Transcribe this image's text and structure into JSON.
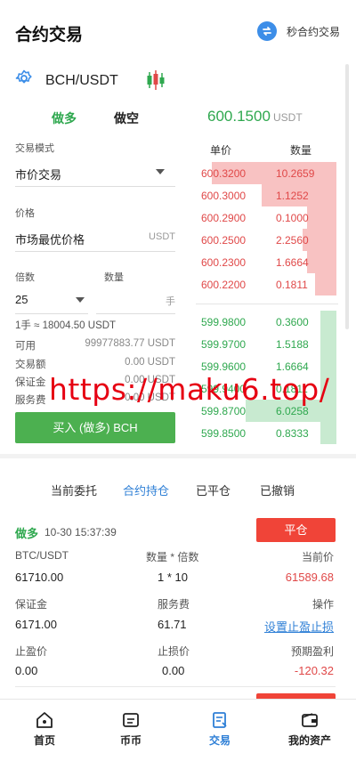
{
  "header": {
    "title": "合约交易",
    "switch_label": "秒合约交易"
  },
  "pair": {
    "name": "BCH/USDT"
  },
  "side_tabs": {
    "long": "做多",
    "short": "做空"
  },
  "ticker": {
    "price": "600.1500",
    "unit": "USDT"
  },
  "form": {
    "mode_label": "交易模式",
    "mode_value": "市价交易",
    "price_label": "价格",
    "price_value": "市场最优价格",
    "price_unit": "USDT",
    "leverage_label": "倍数",
    "qty_label": "数量",
    "leverage_value": "25",
    "qty_unit": "手",
    "lot_hint": "1手 ≈ 18004.50 USDT",
    "available_label": "可用",
    "available_value": "99977883.77 USDT",
    "amount_label": "交易额",
    "amount_value": "0.00 USDT",
    "margin_label": "保证金",
    "margin_value": "0.00 USDT",
    "fee_label": "服务费",
    "fee_value": "0.00 USDT",
    "buy_button": "买入 (做多) BCH"
  },
  "orderbook": {
    "price_header": "单价",
    "qty_header": "数量",
    "asks": [
      {
        "price": "600.3200",
        "qty": "10.2659",
        "depth": 0.92
      },
      {
        "price": "600.3000",
        "qty": "1.1252",
        "depth": 0.55
      },
      {
        "price": "600.2900",
        "qty": "0.1000",
        "depth": 0.22
      },
      {
        "price": "600.2500",
        "qty": "2.2560",
        "depth": 0.25
      },
      {
        "price": "600.2300",
        "qty": "1.6664",
        "depth": 0.22
      },
      {
        "price": "600.2200",
        "qty": "0.1811",
        "depth": 0.16
      }
    ],
    "bids": [
      {
        "price": "599.9800",
        "qty": "0.3600",
        "depth": 0.12
      },
      {
        "price": "599.9700",
        "qty": "1.5188",
        "depth": 0.12
      },
      {
        "price": "599.9600",
        "qty": "1.6664",
        "depth": 0.12
      },
      {
        "price": "599.9400",
        "qty": "0.1811",
        "depth": 0.12
      },
      {
        "price": "599.8700",
        "qty": "6.0258",
        "depth": 0.67
      },
      {
        "price": "599.8500",
        "qty": "0.8333",
        "depth": 0.12
      }
    ]
  },
  "watermark": "https://maku6.top/",
  "order_tabs": [
    "当前委托",
    "合约持仓",
    "已平仓",
    "已撤销"
  ],
  "position": {
    "direction": "做多",
    "time": "10-30 15:37:39",
    "close_button": "平仓",
    "pair_label": "BTC/USDT",
    "qty_lev_label": "数量 * 倍数",
    "current_price_label": "当前价",
    "open_price": "61710.00",
    "qty_lev": "1 * 10",
    "current_price": "61589.68",
    "margin_label": "保证金",
    "fee_label": "服务费",
    "op_label": "操作",
    "margin": "6171.00",
    "fee": "61.71",
    "set_tp_sl": "设置止盈止损",
    "tp_label": "止盈价",
    "sl_label": "止损价",
    "pnl_label": "预期盈利",
    "tp": "0.00",
    "sl": "0.00",
    "pnl": "-120.32"
  },
  "nav": [
    "首页",
    "币币",
    "交易",
    "我的资产"
  ],
  "colors": {
    "green": "#2fa84f",
    "red": "#e04848",
    "blue": "#2e7fd6",
    "buy": "#4cb050",
    "sell": "#f04438"
  }
}
